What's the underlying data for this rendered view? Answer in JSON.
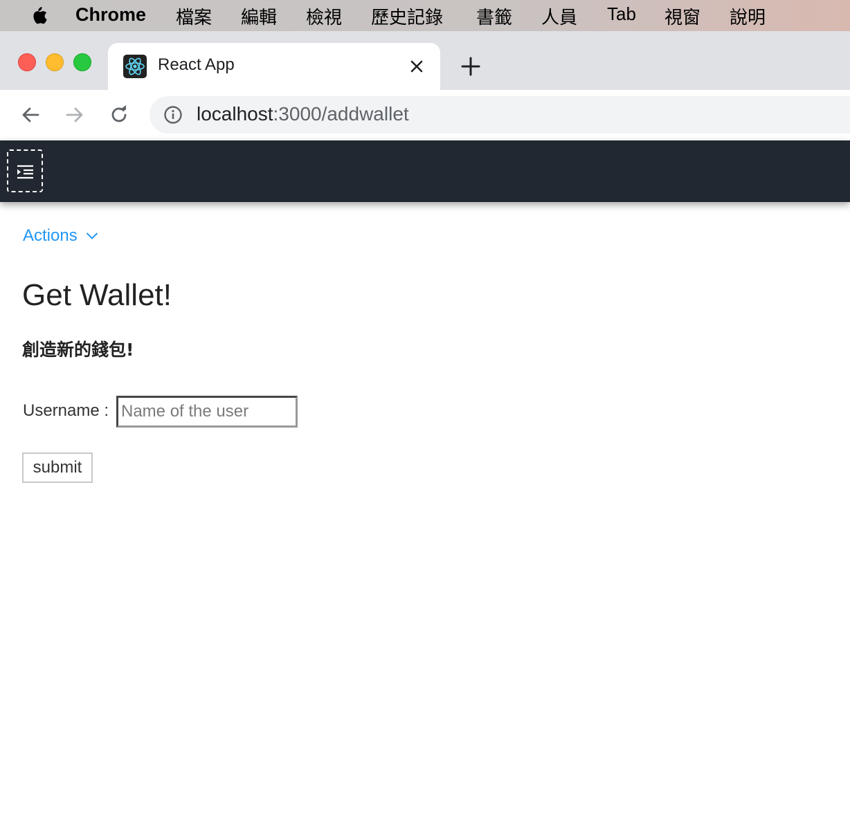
{
  "menubar": {
    "app": "Chrome",
    "items": [
      "檔案",
      "編輯",
      "檢視",
      "歷史記錄",
      "書籤",
      "人員",
      "Tab",
      "視窗",
      "說明"
    ]
  },
  "tab": {
    "title": "React App",
    "favicon": "react-logo-icon"
  },
  "address_bar": {
    "host": "localhost",
    "rest": ":3000/addwallet"
  },
  "actions_menu": {
    "label": "Actions"
  },
  "page": {
    "title": "Get Wallet!",
    "subtitle": "創造新的錢包!",
    "username_label": "Username :",
    "username_placeholder": "Name of the user",
    "submit_label": "submit"
  },
  "colors": {
    "appbar": "#222831",
    "link": "#2196f3",
    "tab_strip": "#dfe1e5"
  }
}
